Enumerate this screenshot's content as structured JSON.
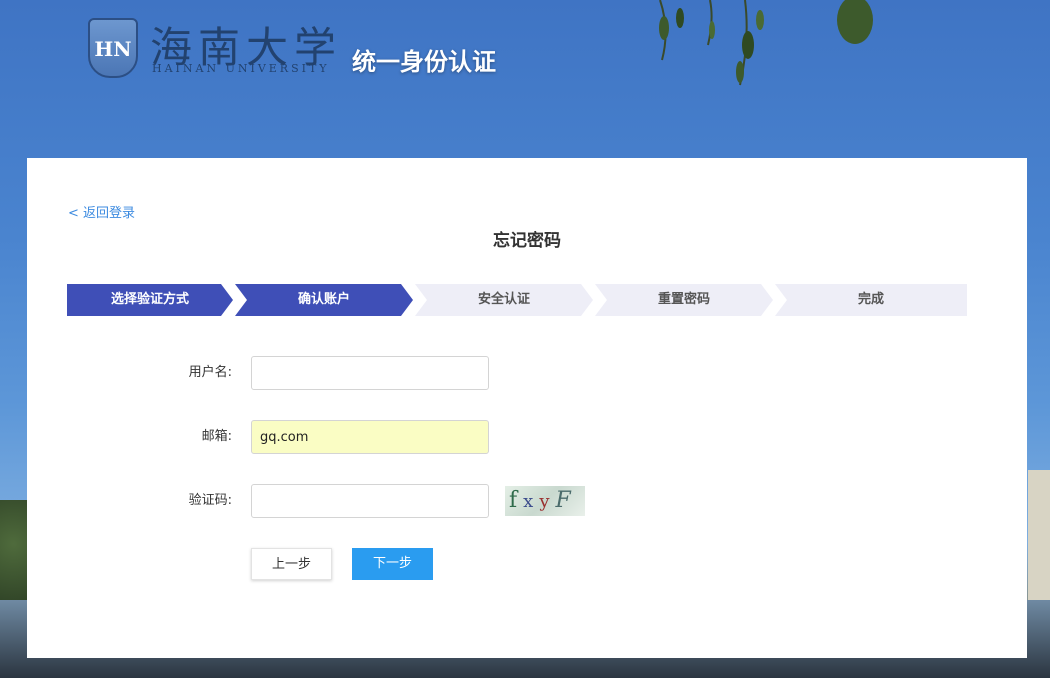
{
  "header": {
    "logo_mark": "HN",
    "logo_cn": "海南大学",
    "logo_en": "HAINAN UNIVERSITY",
    "system_title": "统一身份认证"
  },
  "card": {
    "back_link": "< 返回登录",
    "title": "忘记密码"
  },
  "steps": [
    {
      "label": "选择验证方式",
      "state": "active"
    },
    {
      "label": "确认账户",
      "state": "active"
    },
    {
      "label": "安全认证",
      "state": "inactive"
    },
    {
      "label": "重置密码",
      "state": "inactive"
    },
    {
      "label": "完成",
      "state": "inactive"
    }
  ],
  "form": {
    "username_label": "用户名:",
    "username_value": "",
    "email_label": "邮箱:",
    "email_value": "gq.com",
    "captcha_label": "验证码:",
    "captcha_value": "",
    "captcha_chars": [
      "f",
      "x",
      "y",
      "F"
    ]
  },
  "buttons": {
    "prev": "上一步",
    "next": "下一步"
  },
  "colors": {
    "step_active": "#3f4fb7",
    "step_inactive": "#eeeef7",
    "next_button": "#2a9cf0",
    "link": "#3d8be0",
    "autofill_bg": "#fafdc4"
  }
}
